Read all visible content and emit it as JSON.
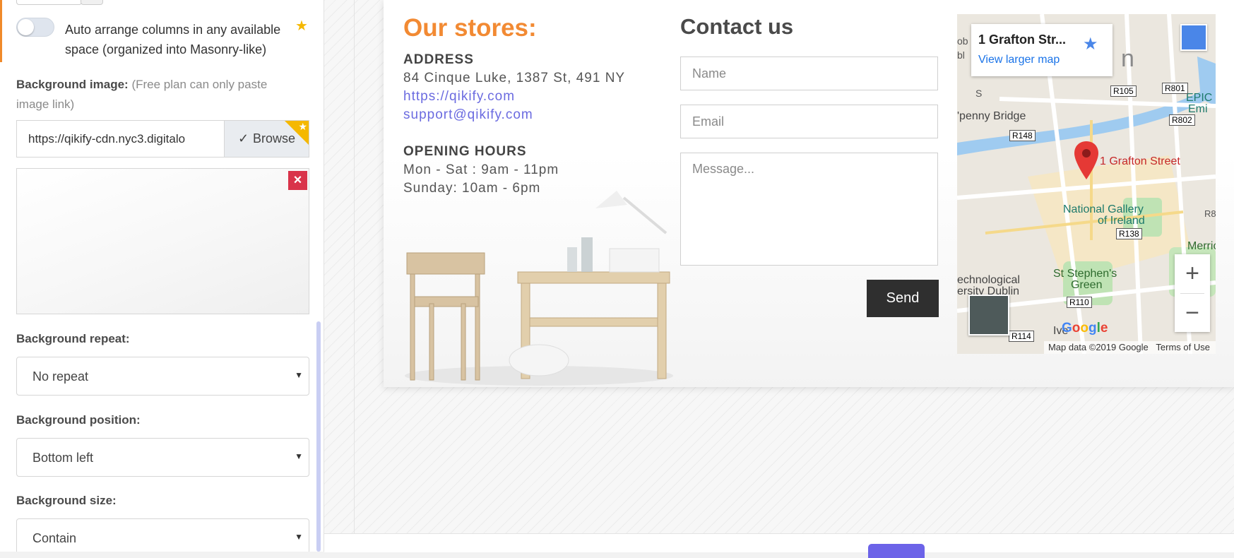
{
  "panel": {
    "auto_arrange": {
      "label": "Auto arrange columns in any available space (organized into Masonry-like)",
      "enabled": false
    },
    "background_image": {
      "label": "Background image:",
      "note": "(Free plan can only paste image link)",
      "url_value": "https://qikify-cdn.nyc3.digitalo",
      "browse_label": "Browse"
    },
    "background_repeat": {
      "label": "Background repeat:",
      "value": "No repeat"
    },
    "background_position": {
      "label": "Background position:",
      "value": "Bottom left"
    },
    "background_size": {
      "label": "Background size:",
      "value": "Contain"
    }
  },
  "section": {
    "stores_title": "Our stores:",
    "address_heading": "ADDRESS",
    "address_line": "84 Cinque Luke, 1387 St, 491 NY",
    "website": "https://qikify.com",
    "email": "support@qikify.com",
    "hours_heading": "OPENING HOURS",
    "hours_weekdays": "Mon - Sat : 9am - 11pm",
    "hours_sunday": "Sunday: 10am - 6pm",
    "contact_title": "Contact us",
    "form": {
      "name_placeholder": "Name",
      "email_placeholder": "Email",
      "message_placeholder": "Message...",
      "send_label": "Send"
    }
  },
  "map": {
    "place_name": "1 Grafton Str...",
    "view_larger": "View larger map",
    "pin_label": "1 Grafton Street",
    "labels": {
      "penny_bridge": "'penny Bridge",
      "national_gallery_1": "National Gallery",
      "national_gallery_2": "of Ireland",
      "st_stephens_1": "St Stephen's",
      "st_stephens_2": "Green",
      "tech_1": "echnological",
      "tech_2": "ersity Dublin",
      "merrion": "Merric",
      "epic": "EPIC",
      "emi": "Emi",
      "ive": "Ive",
      "ob": "ob",
      "bl": "bl",
      "n_letter": "n",
      "s_letter": "S",
      "r8": "R8"
    },
    "road_labels": [
      "R105",
      "R801",
      "R802",
      "R148",
      "R138",
      "R110",
      "R114"
    ],
    "attribution": "Map data ©2019 Google",
    "terms": "Terms of Use",
    "google_letters": [
      "G",
      "o",
      "o",
      "g",
      "l",
      "e"
    ],
    "zoom_in": "+",
    "zoom_out": "−"
  },
  "icons": {
    "toggle_star": "star-icon",
    "browse_check": "check-icon",
    "remove": "close-icon",
    "caret": "chevron-down-icon"
  },
  "colors": {
    "accent_orange": "#f28a33",
    "link": "#6b6be0",
    "pro_star": "#f5b800",
    "remove_red": "#d9334a",
    "send_dark": "#2f2f2f",
    "map_pin": "#e53935"
  }
}
